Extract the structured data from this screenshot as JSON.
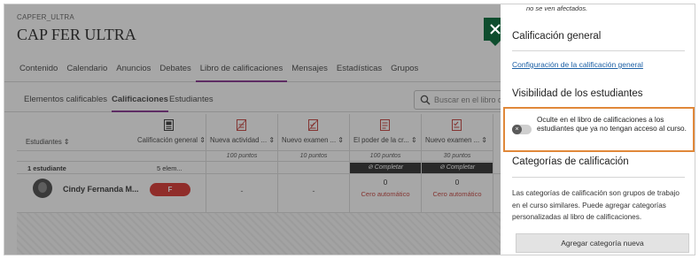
{
  "course": {
    "code": "CAPFER_ULTRA",
    "title": "CAP FER ULTRA"
  },
  "nav": {
    "items": [
      "Contenido",
      "Calendario",
      "Anuncios",
      "Debates",
      "Libro de calificaciones",
      "Mensajes",
      "Estadísticas",
      "Grupos"
    ],
    "active": "Libro de calificaciones"
  },
  "subnav": {
    "items": [
      "Elementos calificables",
      "Calificaciones",
      "Estudiantes"
    ],
    "active": "Calificaciones"
  },
  "search": {
    "placeholder": "Buscar en el libro de"
  },
  "grid": {
    "students_header": "Estudiantes",
    "columns": [
      {
        "label": "Calificación general",
        "icon": "gradebook-icon",
        "points": "",
        "status": "",
        "grade": "",
        "grade_sub": ""
      },
      {
        "label": "Nueva actividad ...",
        "icon": "hidden-assignment-icon",
        "points": "100 puntos",
        "status": "",
        "grade": "-",
        "grade_sub": ""
      },
      {
        "label": "Nuevo examen ...",
        "icon": "hidden-test-icon",
        "points": "10 puntos",
        "status": "",
        "grade": "-",
        "grade_sub": ""
      },
      {
        "label": "El poder de la cr...",
        "icon": "assignment-icon",
        "points": "100 puntos",
        "status": "Completar",
        "grade": "0",
        "grade_sub": "Cero automático"
      },
      {
        "label": "Nuevo examen ...",
        "icon": "test-icon",
        "points": "30 puntos",
        "status": "Completar",
        "grade": "0",
        "grade_sub": "Cero automático"
      }
    ],
    "students_count": "1 estudiante",
    "elements_count": "5 elem...",
    "student": {
      "name": "Cindy Fernanda M...",
      "overall_grade": "F"
    }
  },
  "panel": {
    "top_note": "no se ven afectados.",
    "general_title": "Calificación general",
    "general_link": "Configuración de la calificación general",
    "visibility_title": "Visibilidad de los estudiantes",
    "visibility_text": "Oculte en el libro de calificaciones a los estudiantes que ya no tengan acceso al curso.",
    "visibility_toggle": "off",
    "categories_title": "Categorías de calificación",
    "categories_desc": "Las categorías de calificación son grupos de trabajo en el curso similares. Puede agregar categorías personalizadas al libro de calificaciones.",
    "add_category_button": "Agregar categoría nueva"
  },
  "colors": {
    "accent_purple": "#7a1f86",
    "close_green": "#0e4d2e",
    "highlight_orange": "#e0883a",
    "grade_red": "#d6211d",
    "link_blue": "#1b5fa5"
  }
}
